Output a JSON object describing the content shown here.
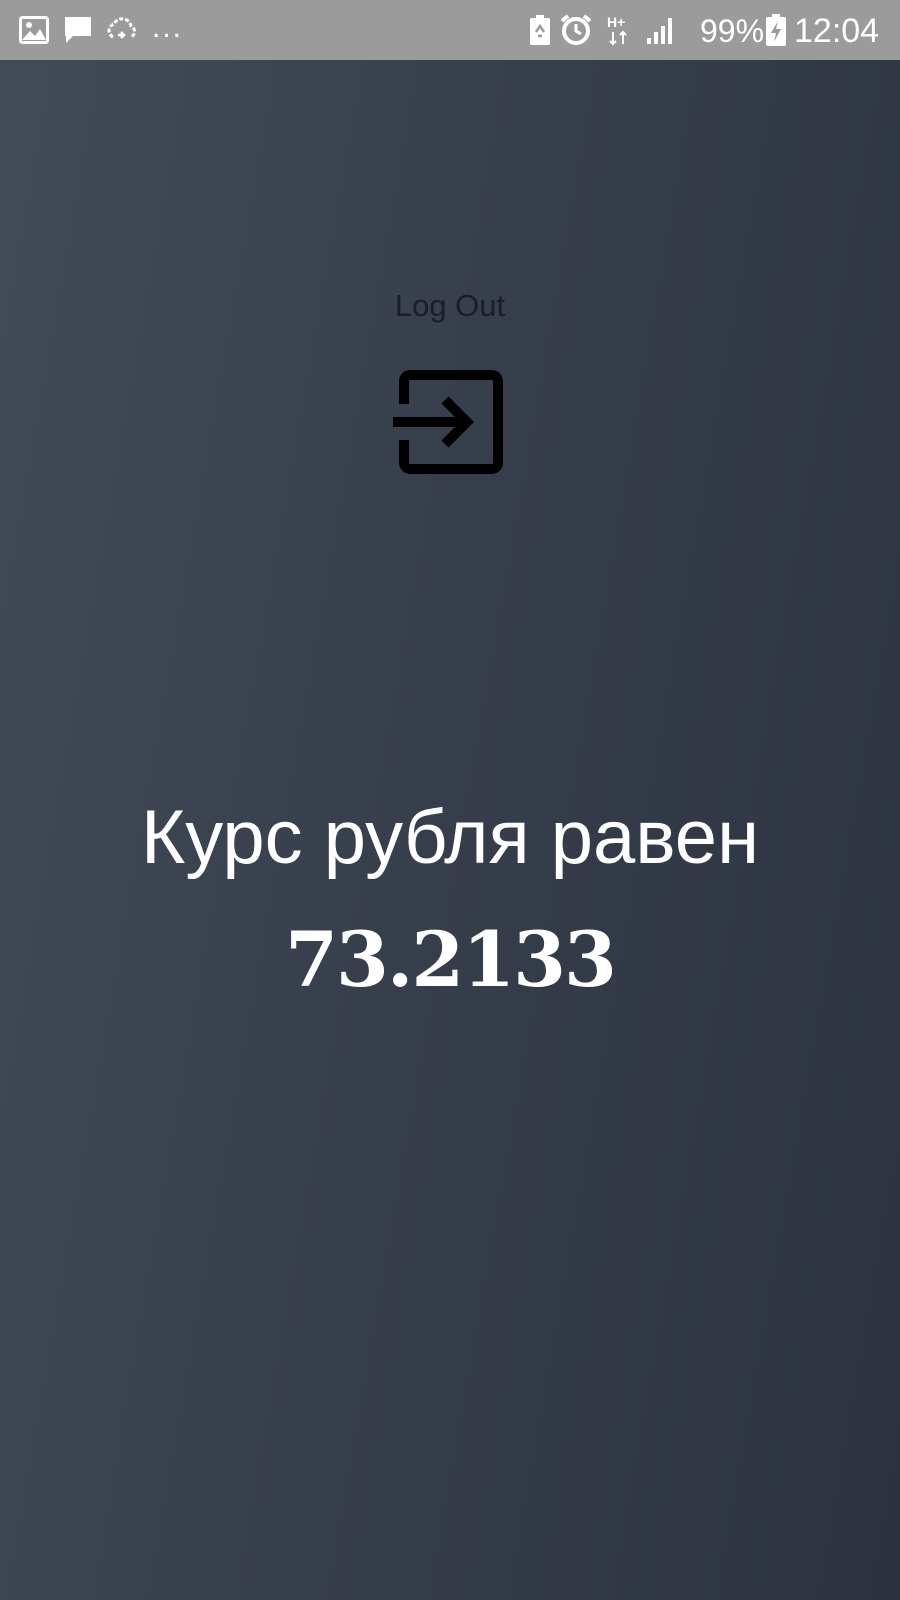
{
  "status_bar": {
    "icons_left": [
      "image-notification-icon",
      "message-notification-icon",
      "sync-cloud-icon"
    ],
    "overflow_text": "...",
    "icons_right": [
      "battery-saver-icon",
      "alarm-icon",
      "network-hplus-icon",
      "signal-strength-icon",
      "battery-charging-icon"
    ],
    "network_type": "H+",
    "battery_percent": "99%",
    "clock": "12:04"
  },
  "logout": {
    "label": "Log Out",
    "icon": "logout-icon"
  },
  "rate": {
    "title": "Курс рубля равен",
    "value": "73.2133"
  },
  "colors": {
    "status_bar_bg": "#9b9b9b",
    "background_light": "#434b58",
    "background_dark": "#2c3240",
    "text_primary": "#ffffff",
    "logout_color": "#1b1e24"
  }
}
